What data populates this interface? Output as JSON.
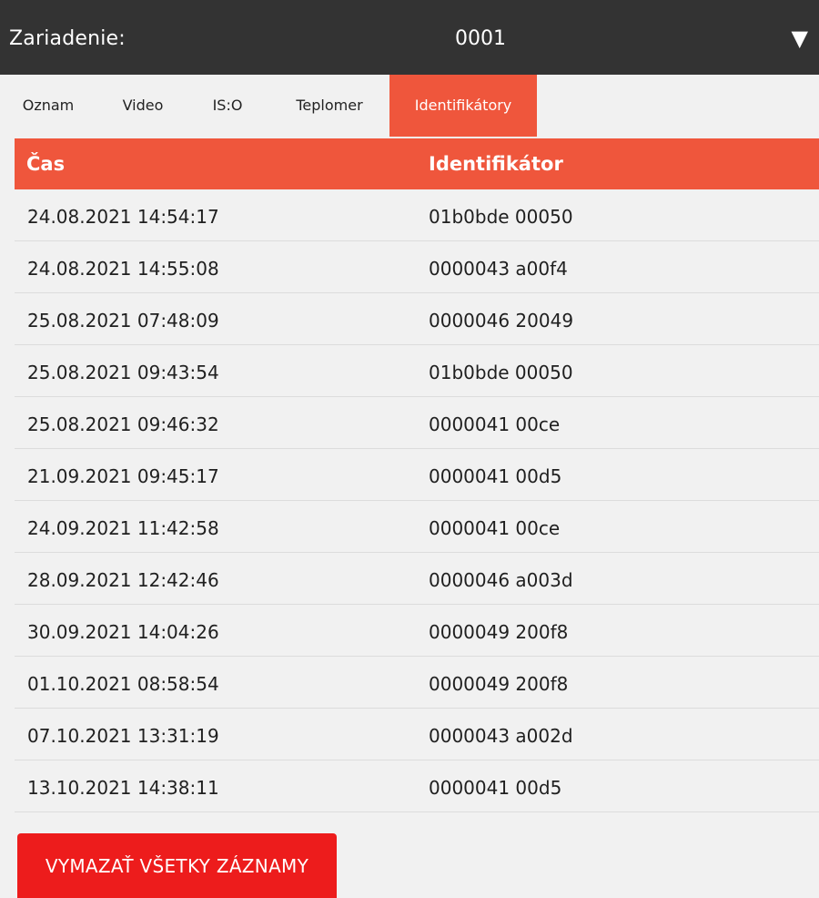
{
  "header": {
    "label": "Zariadenie:",
    "device_value": "0001",
    "dropdown_arrow": "▼"
  },
  "tabs": [
    {
      "label": "Oznam",
      "active": false
    },
    {
      "label": "Video",
      "active": false
    },
    {
      "label": "IS:O",
      "active": false
    },
    {
      "label": "Teplomer",
      "active": false
    },
    {
      "label": "Identifikátory",
      "active": true
    }
  ],
  "table": {
    "columns": [
      "Čas",
      "Identifikátor"
    ],
    "rows": [
      {
        "time": "24.08.2021 14:54:17",
        "identifier": "01b0bde  00050"
      },
      {
        "time": "24.08.2021 14:55:08",
        "identifier": "0000043  a00f4"
      },
      {
        "time": "25.08.2021 07:48:09",
        "identifier": "0000046  20049"
      },
      {
        "time": "25.08.2021 09:43:54",
        "identifier": "01b0bde  00050"
      },
      {
        "time": "25.08.2021 09:46:32",
        "identifier": "0000041  00ce"
      },
      {
        "time": "21.09.2021 09:45:17",
        "identifier": "0000041  00d5"
      },
      {
        "time": "24.09.2021 11:42:58",
        "identifier": "0000041  00ce"
      },
      {
        "time": "28.09.2021 12:42:46",
        "identifier": "0000046  a003d"
      },
      {
        "time": "30.09.2021 14:04:26",
        "identifier": "0000049  200f8"
      },
      {
        "time": "01.10.2021 08:58:54",
        "identifier": "0000049  200f8"
      },
      {
        "time": "07.10.2021 13:31:19",
        "identifier": "0000043  a002d"
      },
      {
        "time": "13.10.2021 14:38:11",
        "identifier": "0000041  00d5"
      }
    ]
  },
  "actions": {
    "delete_all_label": "VYMAZAŤ VŠETKY ZÁZNAMY"
  },
  "colors": {
    "accent": "#ef563c",
    "topbar": "#333333",
    "background": "#f1f1f1",
    "danger": "#ed1c1c"
  }
}
